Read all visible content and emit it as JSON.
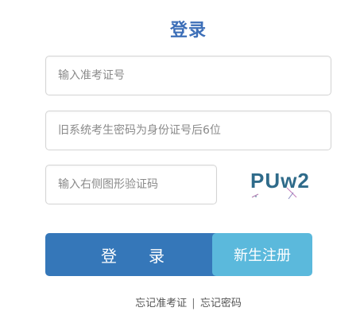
{
  "header": {
    "title": "登录"
  },
  "form": {
    "exam_id_placeholder": "输入准考证号",
    "password_placeholder": "旧系统考生密码为身份证号后6位",
    "captcha_placeholder": "输入右侧图形验证码",
    "captcha_text": "PUw2"
  },
  "buttons": {
    "login_label": "登　　录",
    "register_label": "新生注册"
  },
  "links": {
    "forgot_exam_id": "忘记准考证",
    "separator": "|",
    "forgot_password": "忘记密码"
  },
  "colors": {
    "title": "#3d6fb8",
    "login_button": "#3577b9",
    "register_button": "#5bb9dc",
    "captcha_text": "#2f6b8a"
  }
}
